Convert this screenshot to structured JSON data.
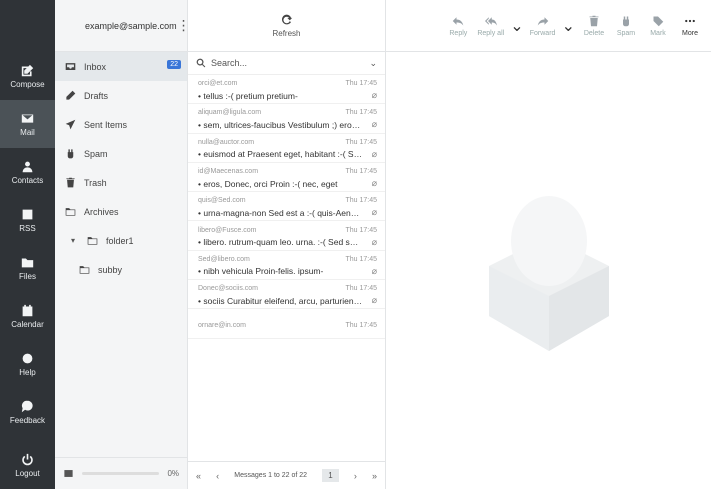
{
  "account": {
    "email": "example@sample.com"
  },
  "rail": [
    {
      "label": "Compose",
      "icon": "compose-icon",
      "active": false
    },
    {
      "label": "Mail",
      "icon": "mail-icon",
      "active": true
    },
    {
      "label": "Contacts",
      "icon": "contacts-icon",
      "active": false
    },
    {
      "label": "RSS",
      "icon": "rss-icon",
      "active": false
    },
    {
      "label": "Files",
      "icon": "files-icon",
      "active": false
    },
    {
      "label": "Calendar",
      "icon": "calendar-icon",
      "active": false
    },
    {
      "label": "Help",
      "icon": "help-icon",
      "active": false
    },
    {
      "label": "Feedback",
      "icon": "feedback-icon",
      "active": false
    }
  ],
  "logout_label": "Logout",
  "folders": [
    {
      "label": "Inbox",
      "icon": "inbox-icon",
      "badge": "22"
    },
    {
      "label": "Drafts",
      "icon": "drafts-icon"
    },
    {
      "label": "Sent Items",
      "icon": "sent-icon"
    },
    {
      "label": "Spam",
      "icon": "spam-icon"
    },
    {
      "label": "Trash",
      "icon": "trash-icon"
    },
    {
      "label": "Archives",
      "icon": "archive-icon"
    },
    {
      "label": "folder1",
      "icon": "folder-icon"
    },
    {
      "label": "subby",
      "icon": "folder-icon"
    }
  ],
  "quota": {
    "percent_label": "0%",
    "used_fraction": 0
  },
  "list_header": {
    "refresh_label": "Refresh"
  },
  "search": {
    "placeholder": "Search..."
  },
  "messages": [
    {
      "from": "orci@et.com",
      "date": "Thu 17:45",
      "subject": "tellus :-( pretium pretium-",
      "attachment": true
    },
    {
      "from": "aliquam@ligula.com",
      "date": "Thu 17:45",
      "subject": "sem, ultrices-faucibus Vestibulum ;) eros ...",
      "attachment": true
    },
    {
      "from": "nulla@auctor.com",
      "date": "Thu 17:45",
      "subject": "euismod at Praesent eget, habitant :-( Sus...",
      "attachment": true
    },
    {
      "from": "id@Maecenas.com",
      "date": "Thu 17:45",
      "subject": "eros, Donec, orci Proin :-( nec, eget",
      "attachment": true
    },
    {
      "from": "quis@Sed.com",
      "date": "Thu 17:45",
      "subject": "urna-magna-non Sed est a :-( quis-Aenean...",
      "attachment": true
    },
    {
      "from": "libero@Fusce.com",
      "date": "Thu 17:45",
      "subject": "libero. rutrum-quam leo. urna. :-( Sed sed...",
      "attachment": true
    },
    {
      "from": "Sed@libero.com",
      "date": "Thu 17:45",
      "subject": "nibh vehicula Proin-felis. ipsum-",
      "attachment": true
    },
    {
      "from": "Donec@sociis.com",
      "date": "Thu 17:45",
      "subject": "sociis Curabitur eleifend, arcu, parturient ...",
      "attachment": true
    },
    {
      "from": "ornare@in.com",
      "date": "Thu 17:45",
      "subject": "",
      "attachment": false
    }
  ],
  "pager": {
    "first": "«",
    "prev": "‹",
    "info": "Messages 1 to 22 of 22",
    "page": "1",
    "next": "›",
    "last": "»"
  },
  "toolbar": [
    {
      "label": "Reply",
      "icon": "reply-icon",
      "dropdown": false
    },
    {
      "label": "Reply all",
      "icon": "reply-all-icon",
      "dropdown": true
    },
    {
      "label": "Forward",
      "icon": "forward-icon",
      "dropdown": true
    },
    {
      "label": "Delete",
      "icon": "trash-icon",
      "dropdown": false
    },
    {
      "label": "Spam",
      "icon": "spam-icon",
      "dropdown": false
    },
    {
      "label": "Mark",
      "icon": "mark-icon",
      "dropdown": false
    },
    {
      "label": "More",
      "icon": "more-icon",
      "dropdown": false
    }
  ]
}
